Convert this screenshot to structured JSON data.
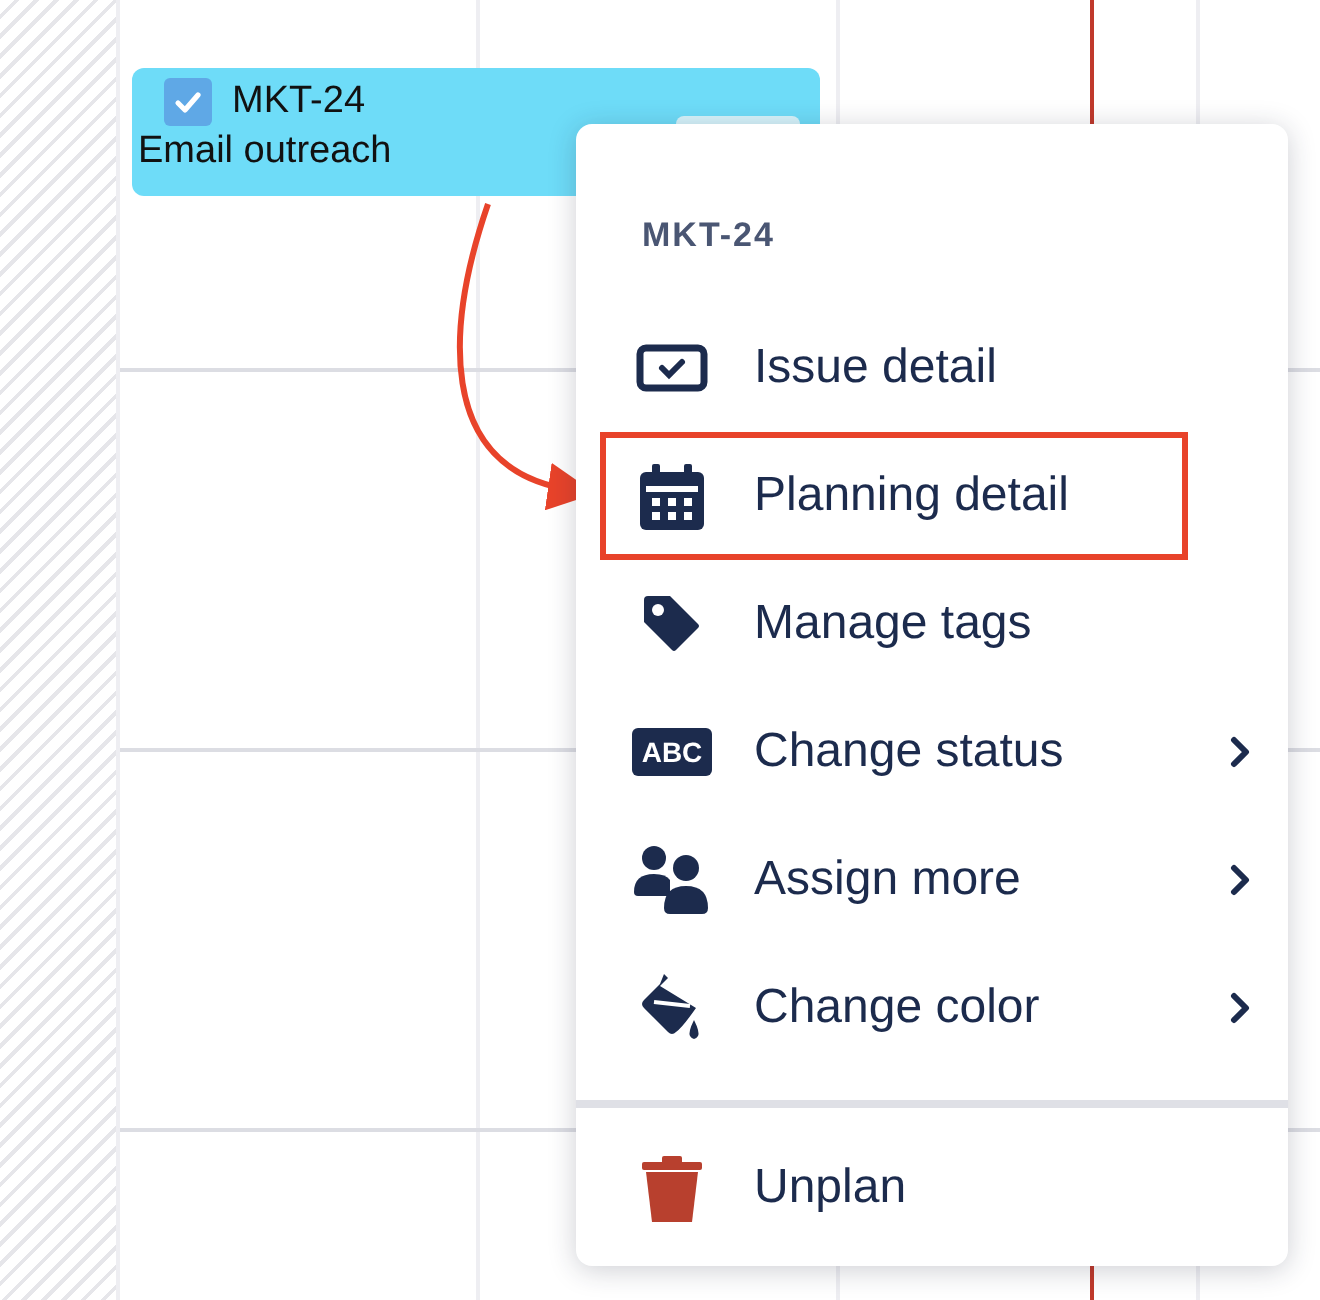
{
  "card": {
    "key": "MKT-24",
    "title": "Email outreach",
    "checked": true
  },
  "menu": {
    "header": "MKT-24",
    "items": [
      {
        "label": "Issue detail",
        "kind": "normal",
        "highlighted": false,
        "has_submenu": false
      },
      {
        "label": "Planning detail",
        "kind": "normal",
        "highlighted": true,
        "has_submenu": false
      },
      {
        "label": "Manage tags",
        "kind": "normal",
        "highlighted": false,
        "has_submenu": false
      },
      {
        "label": "Change status",
        "kind": "normal",
        "highlighted": false,
        "has_submenu": true,
        "icon_text": "ABC"
      },
      {
        "label": "Assign more",
        "kind": "normal",
        "highlighted": false,
        "has_submenu": true
      },
      {
        "label": "Change color",
        "kind": "normal",
        "highlighted": false,
        "has_submenu": true
      },
      {
        "label": "Unplan",
        "kind": "danger",
        "highlighted": false,
        "has_submenu": false
      }
    ]
  }
}
